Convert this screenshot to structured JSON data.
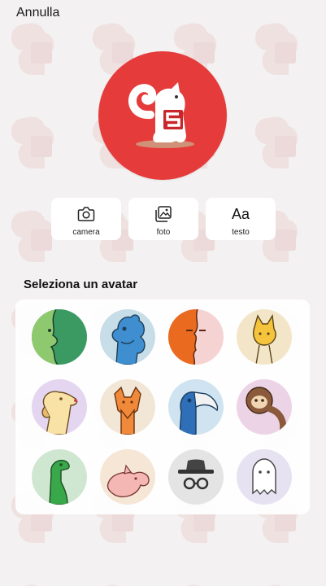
{
  "header": {
    "cancel_label": "Annulla"
  },
  "main_avatar": {
    "icon": "squirrel-mascot-icon",
    "color": "#e63b3b"
  },
  "actions": [
    {
      "label": "camera",
      "icon": "camera-icon"
    },
    {
      "label": "foto",
      "icon": "photo-icon"
    },
    {
      "label": "testo",
      "icon": "text-icon",
      "glyph": "Aa"
    }
  ],
  "avatar_section": {
    "title": "Seleziona un avatar",
    "avatars": [
      "green-face-avatar",
      "blue-monster-avatar",
      "orange-face-avatar",
      "cat-avatar",
      "dog-avatar",
      "fox-avatar",
      "toucan-avatar",
      "sloth-avatar",
      "dinosaur-avatar",
      "pig-avatar",
      "spy-hat-glasses-avatar",
      "ghost-avatar"
    ]
  }
}
